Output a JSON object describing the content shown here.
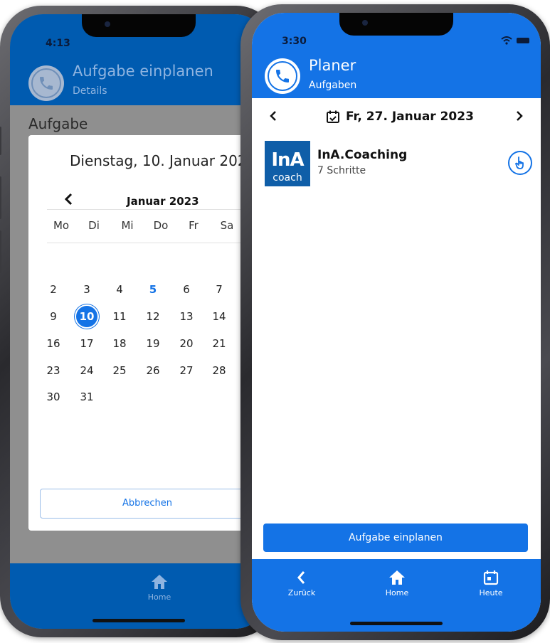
{
  "back_screen": {
    "status": {
      "time": "4:13"
    },
    "header": {
      "title": "Aufgabe einplanen",
      "subtitle": "Details"
    },
    "section_heading": "Aufgabe",
    "dialog": {
      "selected_date_text": "Dienstag, 10. Januar 202",
      "month_label": "Januar 2023",
      "weekdays": [
        "Mo",
        "Di",
        "Mi",
        "Do",
        "Fr",
        "Sa"
      ],
      "weeks": [
        [
          "2",
          "3",
          "4",
          "5",
          "6",
          "7"
        ],
        [
          "9",
          "10",
          "11",
          "12",
          "13",
          "14"
        ],
        [
          "16",
          "17",
          "18",
          "19",
          "20",
          "21"
        ],
        [
          "23",
          "24",
          "25",
          "26",
          "27",
          "28"
        ],
        [
          "30",
          "31"
        ]
      ],
      "selected_day": "10",
      "today_day": "5",
      "cancel_label": "Abbrechen"
    },
    "bottom_nav": {
      "home_label": "Home"
    }
  },
  "front_screen": {
    "status": {
      "time": "3:30"
    },
    "header": {
      "title": "Planer",
      "subtitle": "Aufgaben"
    },
    "date_bar": {
      "date": "Fr, 27. Januar 2023"
    },
    "task": {
      "logo_main": "InA",
      "logo_sub": "coach",
      "title": "InA.Coaching",
      "subtitle": "7 Schritte"
    },
    "plan_button_label": "Aufgabe einplanen",
    "bottom_nav": {
      "back_label": "Zurück",
      "home_label": "Home",
      "today_label": "Heute"
    }
  },
  "colors": {
    "primary": "#1473e6",
    "header_dark": "#005bb0",
    "logo_bg": "#0f5ea8"
  },
  "icons": [
    "phone-icon",
    "chevron-left-icon",
    "chevron-right-icon",
    "calendar-check-icon",
    "home-icon",
    "calendar-today-icon",
    "hand-pointer-icon",
    "wifi-icon",
    "battery-icon"
  ]
}
